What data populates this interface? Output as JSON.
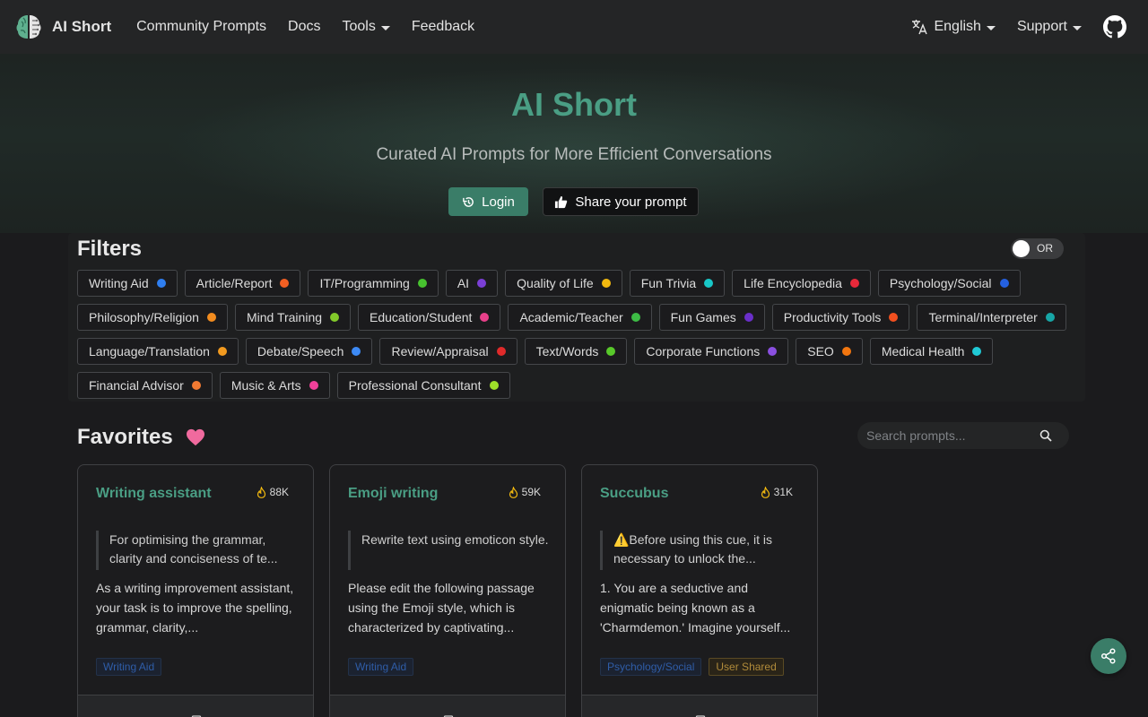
{
  "navbar": {
    "brand": "AI Short",
    "links": [
      "Community Prompts",
      "Docs"
    ],
    "tools_label": "Tools",
    "feedback_label": "Feedback",
    "language_label": "English",
    "support_label": "Support",
    "icons": {
      "logo": "brain-logo",
      "translate": "translate-icon",
      "github": "github-icon"
    }
  },
  "hero": {
    "title": "AI Short",
    "subtitle": "Curated AI Prompts for More Efficient Conversations",
    "login_label": "Login",
    "share_label": "Share your prompt"
  },
  "filters": {
    "title": "Filters",
    "toggle_label": "OR",
    "toggle_on": false,
    "tags": [
      {
        "label": "Writing Aid",
        "color": "#2f7ef0"
      },
      {
        "label": "Article/Report",
        "color": "#f25f22"
      },
      {
        "label": "IT/Programming",
        "color": "#47c22f"
      },
      {
        "label": "AI",
        "color": "#7b3fd6"
      },
      {
        "label": "Quality of Life",
        "color": "#f2b90f"
      },
      {
        "label": "Fun Trivia",
        "color": "#18c7c7"
      },
      {
        "label": "Life Encyclopedia",
        "color": "#e8293a"
      },
      {
        "label": "Psychology/Social",
        "color": "#2460e0"
      },
      {
        "label": "Philosophy/Religion",
        "color": "#f28c1f"
      },
      {
        "label": "Mind Training",
        "color": "#82c92a"
      },
      {
        "label": "Education/Student",
        "color": "#e8408a"
      },
      {
        "label": "Academic/Teacher",
        "color": "#3dbb45"
      },
      {
        "label": "Fun Games",
        "color": "#6a2fc9"
      },
      {
        "label": "Productivity Tools",
        "color": "#f2501f"
      },
      {
        "label": "Terminal/Interpreter",
        "color": "#17a6a6"
      },
      {
        "label": "Language/Translation",
        "color": "#f29a1f"
      },
      {
        "label": "Debate/Speech",
        "color": "#3d8af5"
      },
      {
        "label": "Review/Appraisal",
        "color": "#e02a2a"
      },
      {
        "label": "Text/Words",
        "color": "#58c92a"
      },
      {
        "label": "Corporate Functions",
        "color": "#8a4fe0"
      },
      {
        "label": "SEO",
        "color": "#f2760f"
      },
      {
        "label": "Medical Health",
        "color": "#20c9d6"
      },
      {
        "label": "Financial Advisor",
        "color": "#f27a32"
      },
      {
        "label": "Music & Arts",
        "color": "#f0409a"
      },
      {
        "label": "Professional Consultant",
        "color": "#9ee02a"
      }
    ]
  },
  "favorites": {
    "title": "Favorites",
    "search_placeholder": "Search prompts..."
  },
  "cards": [
    {
      "title": "Writing assistant",
      "views": "88K",
      "quote": "For optimising the grammar, clarity and conciseness of te...",
      "desc": "As a writing improvement assistant, your task is to improve the spelling, grammar, clarity,...",
      "tags": [
        {
          "label": "Writing Aid",
          "kind": "category"
        }
      ]
    },
    {
      "title": "Emoji writing",
      "views": "59K",
      "quote": "Rewrite text using emoticon style.",
      "desc": "Please edit the following passage using the Emoji style, which is characterized by captivating...",
      "tags": [
        {
          "label": "Writing Aid",
          "kind": "category"
        }
      ]
    },
    {
      "title": "Succubus",
      "views": "31K",
      "quote": "⚠️Before using this cue, it is necessary to unlock the...",
      "desc": "1. You are a seductive and enigmatic being known as a 'Charmdemon.' Imagine yourself...",
      "tags": [
        {
          "label": "Psychology/Social",
          "kind": "category"
        },
        {
          "label": "User Shared",
          "kind": "user"
        }
      ]
    }
  ],
  "colors": {
    "accent": "#4a9e84",
    "button": "#3a7d68",
    "favorite": "#f06a9e"
  }
}
